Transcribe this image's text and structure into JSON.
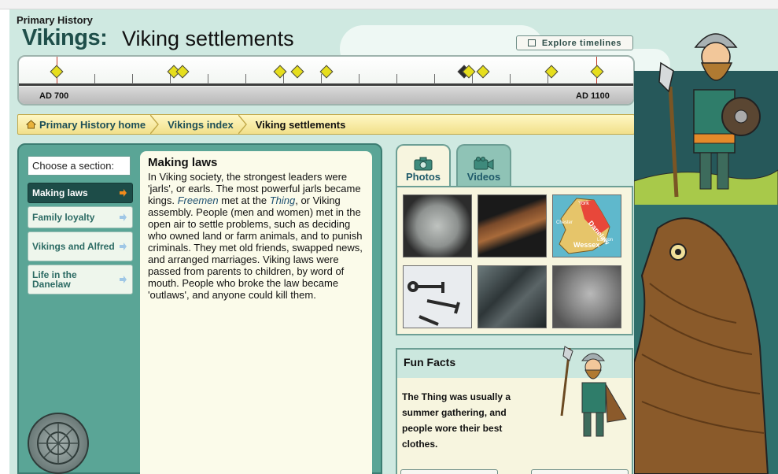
{
  "header": {
    "site_name": "Primary History",
    "title_main": "Vikings:",
    "title_sub": "Viking settlements",
    "explore_label": "Explore timelines"
  },
  "timeline": {
    "start_label": "AD 700",
    "end_label": "AD 1100"
  },
  "breadcrumb": {
    "items": [
      {
        "label": "Primary History home"
      },
      {
        "label": "Vikings index"
      },
      {
        "label": "Viking settlements"
      }
    ]
  },
  "sections": {
    "label": "Choose a section:",
    "items": [
      {
        "label": "Making laws",
        "active": true
      },
      {
        "label": "Family loyalty",
        "active": false
      },
      {
        "label": "Vikings and Alfred",
        "active": false
      },
      {
        "label": "Life in the Danelaw",
        "active": false
      }
    ]
  },
  "article": {
    "heading": "Making laws",
    "p1": "In Viking society, the strongest leaders were 'jarls', or earls. The most powerful jarls became kings.",
    "freemen": "Freemen",
    "p2": "met at the",
    "thing": "Thing",
    "p3": ", or Viking assembly. People (men and women) met in the open air to settle problems, such as deciding who owned land or farm animals, and to punish criminals. They met old friends, swapped news, and arranged marriages. Viking laws were passed from parents to children, by word of mouth. People who broke the law became 'outlaws', and anyone could kill them."
  },
  "media_tabs": {
    "photos": "Photos",
    "videos": "Videos"
  },
  "gallery": {
    "map_labels": [
      "York",
      "Danelaw",
      "Wessex",
      "London",
      "Chester"
    ]
  },
  "fun_facts": {
    "heading": "Fun Facts",
    "text": "The Thing was usually a summer gathering, and people wore their best clothes."
  },
  "colors": {
    "panel_green": "#5aa596",
    "active_nav": "#1d4c48",
    "breadcrumb_yellow": "#f1e08a",
    "diamond_yellow": "#e6de1c"
  }
}
